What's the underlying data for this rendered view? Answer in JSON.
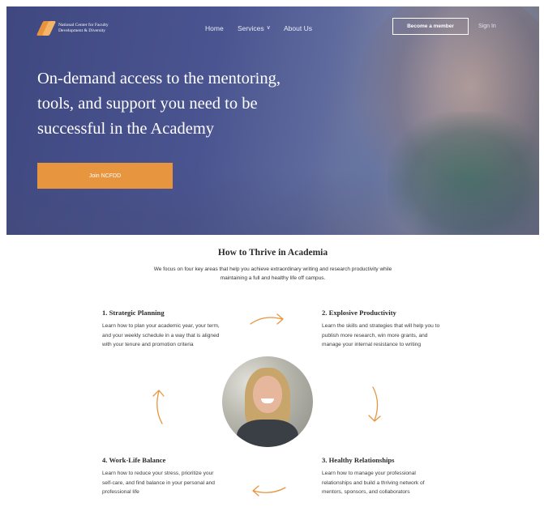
{
  "brand": {
    "line1": "National Center for Faculty",
    "line2": "Development & Diversity",
    "logo_icon": "ncfdd-logo-icon",
    "accent_color": "#e8953f"
  },
  "nav": {
    "home": "Home",
    "services": "Services",
    "about": "About Us",
    "services_icon": "chevron-down-icon"
  },
  "header": {
    "member_button": "Become a member",
    "signin": "Sign In"
  },
  "hero": {
    "title": "On-demand access to the mentoring,\ntools, and support you need to be\nsuccessful in the Academy",
    "cta": "Join NCFDD"
  },
  "section": {
    "title": "How to Thrive in Academia",
    "subtitle": "We focus on four key areas that help you achieve extraordinary writing and research productivity while maintaining a full and healthy life off campus."
  },
  "areas": [
    {
      "title": "1. Strategic Planning",
      "text": "Learn how to plan your academic year, your term, and your weekly schedule in a way that is aligned with your tenure and promotion criteria"
    },
    {
      "title": "2. Explosive Productivity",
      "text": "Learn the skills and strategies that will help you to publish more research, win more grants, and manage your internal resistance to writing"
    },
    {
      "title": "3. Healthy Relationships",
      "text": "Learn how to manage your professional relationships and build a thriving network of mentors, sponsors, and collaborators"
    },
    {
      "title": "4. Work-Life Balance",
      "text": "Learn how to reduce your stress, prioritize your self-care, and find balance in your personal and professional life"
    }
  ]
}
